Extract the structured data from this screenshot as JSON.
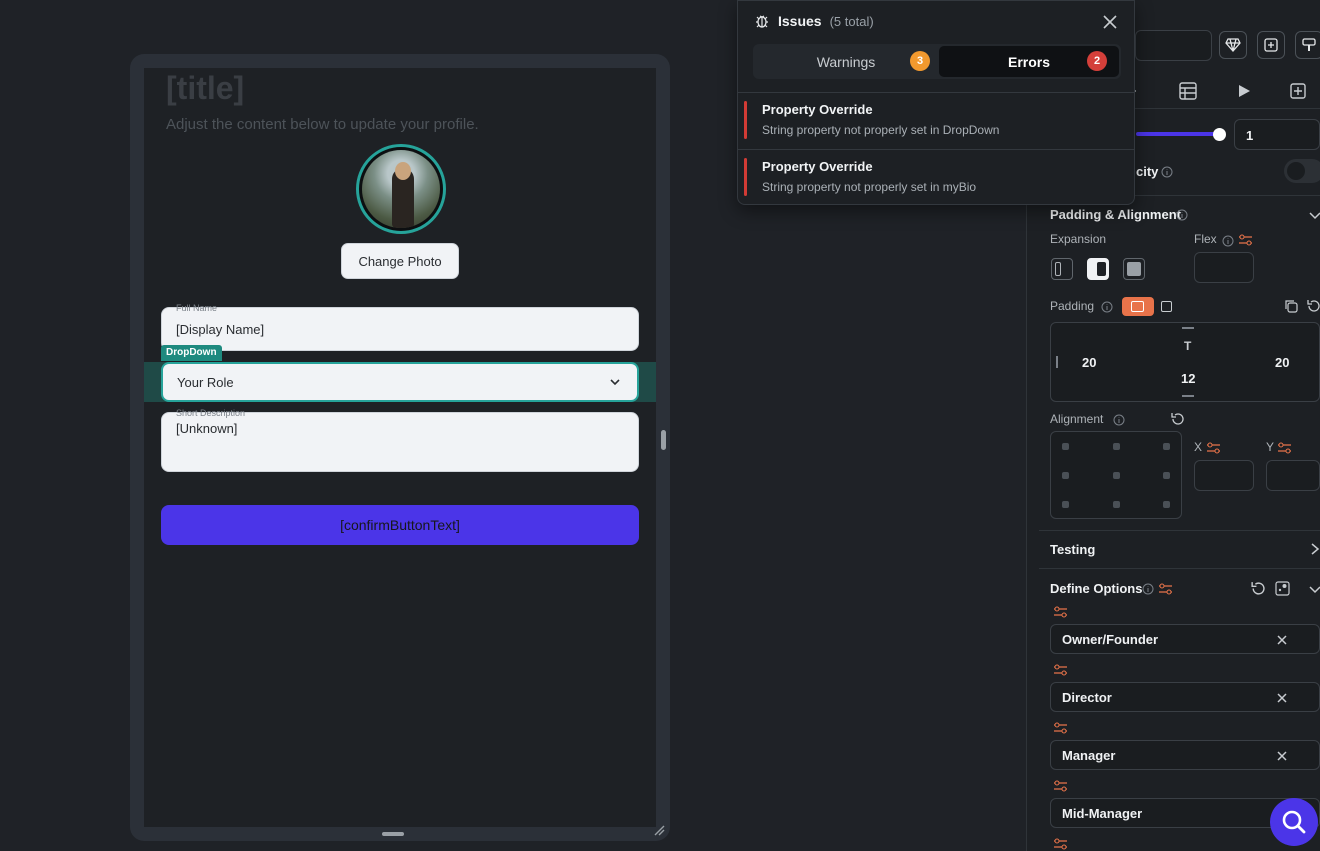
{
  "canvas": {
    "title": "[title]",
    "subtitle": "Adjust the content below to update your profile.",
    "change_photo_label": "Change Photo",
    "full_name": {
      "label": "Full Name",
      "value": "[Display Name]"
    },
    "dropdown": {
      "tag": "DropDown",
      "value": "Your Role"
    },
    "short_description": {
      "label": "Short Description",
      "value": "[Unknown]"
    },
    "confirm_button_text": "[confirmButtonText]"
  },
  "issues": {
    "title": "Issues",
    "count_text": "(5 total)",
    "tabs": [
      {
        "label": "Warnings",
        "count": "3",
        "color": "#f2992e"
      },
      {
        "label": "Errors",
        "count": "2",
        "color": "#d43f3a",
        "active": true
      }
    ],
    "items": [
      {
        "title": "Property Override",
        "description": "String property not properly set in DropDown"
      },
      {
        "title": "Property Override",
        "description": "String property not properly set in myBio"
      }
    ]
  },
  "panel": {
    "opacity_value": "1",
    "opacity_label_fragment": "city",
    "padding_alignment": {
      "title": "Padding & Alignment",
      "expansion_label": "Expansion",
      "flex_label": "Flex"
    },
    "padding": {
      "label": "Padding",
      "top_marker": "T",
      "left": "20",
      "right": "20",
      "bottom": "12"
    },
    "alignment": {
      "label": "Alignment",
      "x_label": "X",
      "y_label": "Y"
    },
    "testing": {
      "title": "Testing"
    },
    "define_options": {
      "title": "Define Options",
      "options": [
        "Owner/Founder",
        "Director",
        "Manager",
        "Mid-Manager"
      ]
    }
  },
  "colors": {
    "accent": "#4b35e8",
    "teal": "#26a39a",
    "error": "#d43f3a",
    "warning": "#f2992e",
    "orange": "#e8734a"
  },
  "icons": [
    "bug-icon",
    "close-icon",
    "chevron-down-icon",
    "gem-icon",
    "add-page-icon",
    "paint-brush-icon",
    "table-icon",
    "play-icon",
    "info-icon",
    "settings-sliders-icon",
    "reset-icon",
    "copy-icon",
    "search-icon"
  ]
}
